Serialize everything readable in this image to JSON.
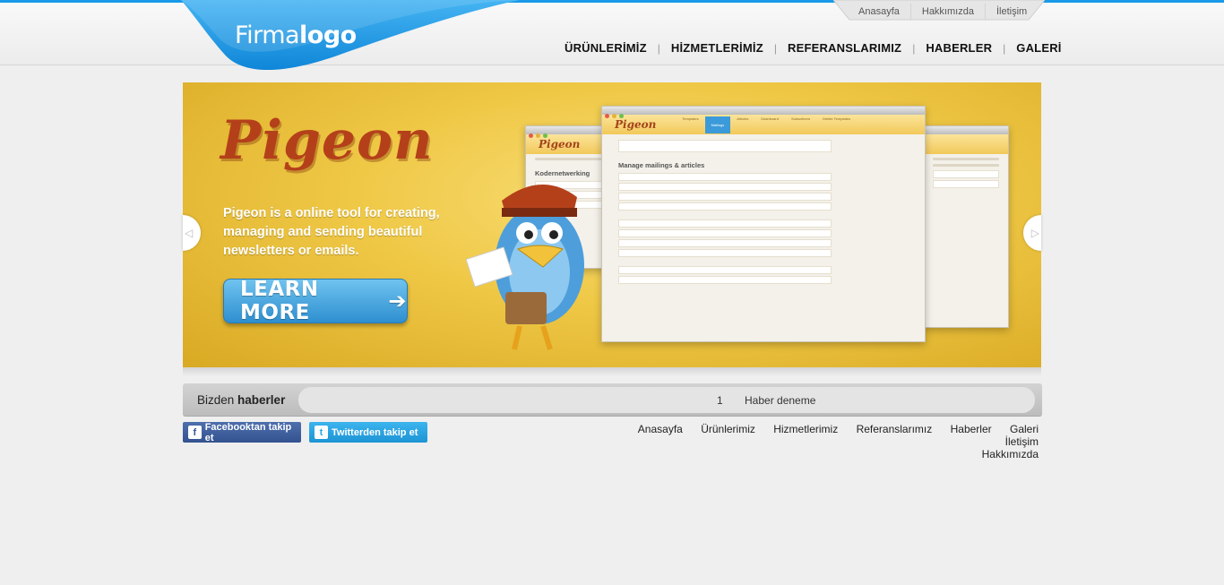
{
  "header": {
    "logo_light": "Firma",
    "logo_bold": "logo",
    "top_links": [
      "Anasayfa",
      "Hakkımızda",
      "İletişim"
    ],
    "main_nav": [
      "ÜRÜNLERİMİZ",
      "HİZMETLERİMİZ",
      "REFERANSLARIMIZ",
      "HABERLER",
      "GALERİ"
    ],
    "nav_separator": "|"
  },
  "slider": {
    "title": "Pigeon",
    "description": "Pigeon is a online tool for creating, managing and sending beautiful newsletters or emails.",
    "button_label": "LEARN MORE",
    "button_arrow": "➔",
    "prev_arrow": "◁",
    "next_arrow": "▷",
    "screenshot": {
      "app_name": "Pigeon",
      "tabs": [
        "Templates",
        "Mailings",
        "Articles",
        "Dashboard",
        "Subscribers",
        "Delete Templates"
      ],
      "heading": "Manage mailings & articles",
      "side_app_name": "Pigeon",
      "side_heading": "Kodernetwerking"
    },
    "accent_color": "#efc846",
    "title_color": "#b4401a"
  },
  "news": {
    "label_light": "Bizden",
    "label_bold": "haberler",
    "items": [
      {
        "number": "1",
        "text": "Haber deneme"
      }
    ]
  },
  "social": {
    "facebook_label": "Facebooktan takip et",
    "facebook_icon": "f",
    "twitter_label": "Twitterden takip et",
    "twitter_icon": "t"
  },
  "footer_nav": [
    "Anasayfa",
    "Ürünlerimiz",
    "Hizmetlerimiz",
    "Referanslarımız",
    "Haberler",
    "Galeri",
    "İletişim",
    "Hakkımızda"
  ],
  "colors": {
    "brand_blue": "#1a9ae8",
    "facebook": "#3b5998",
    "twitter": "#29a9e4"
  }
}
